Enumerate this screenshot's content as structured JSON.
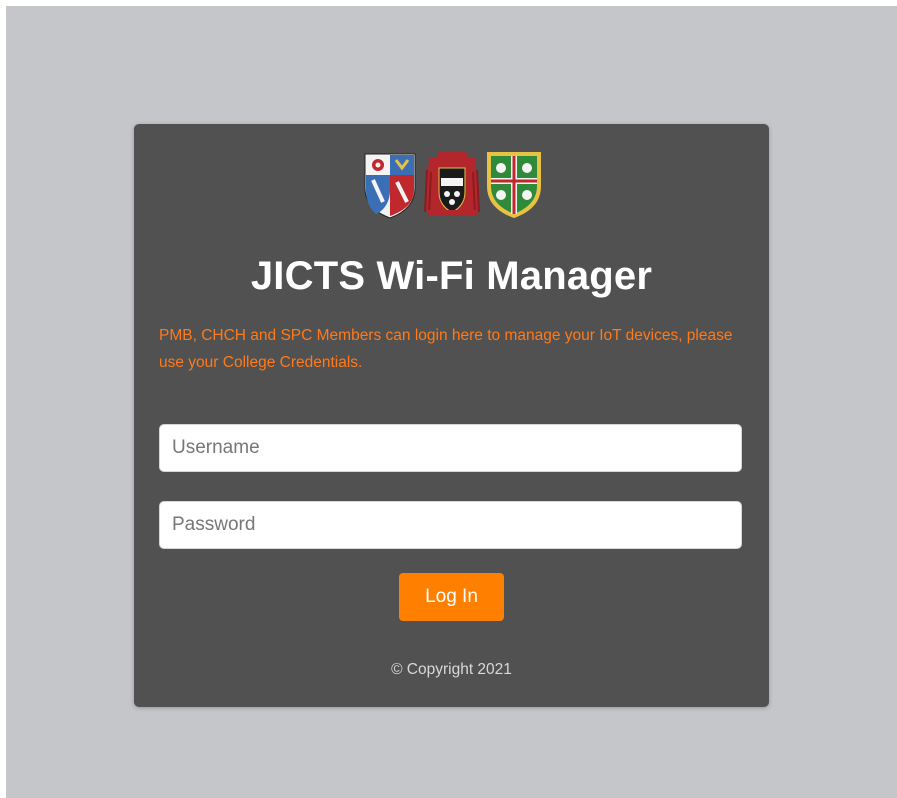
{
  "page": {
    "title": "JICTS Wi-Fi Manager",
    "notice": "PMB, CHCH and SPC Members can login here to manage your IoT devices, please use your College Credentials.",
    "copyright": "© Copyright 2021"
  },
  "crests": [
    {
      "icon": "pmb-crest-icon"
    },
    {
      "icon": "chch-crest-icon"
    },
    {
      "icon": "spc-crest-icon"
    }
  ],
  "form": {
    "username": {
      "value": "",
      "placeholder": "Username"
    },
    "password": {
      "value": "",
      "placeholder": "Password"
    },
    "login_label": "Log In"
  },
  "colors": {
    "background": "#c5c6ca",
    "card": "#515151",
    "accent": "#ff7f00",
    "notice_text": "#ff7a1a"
  }
}
